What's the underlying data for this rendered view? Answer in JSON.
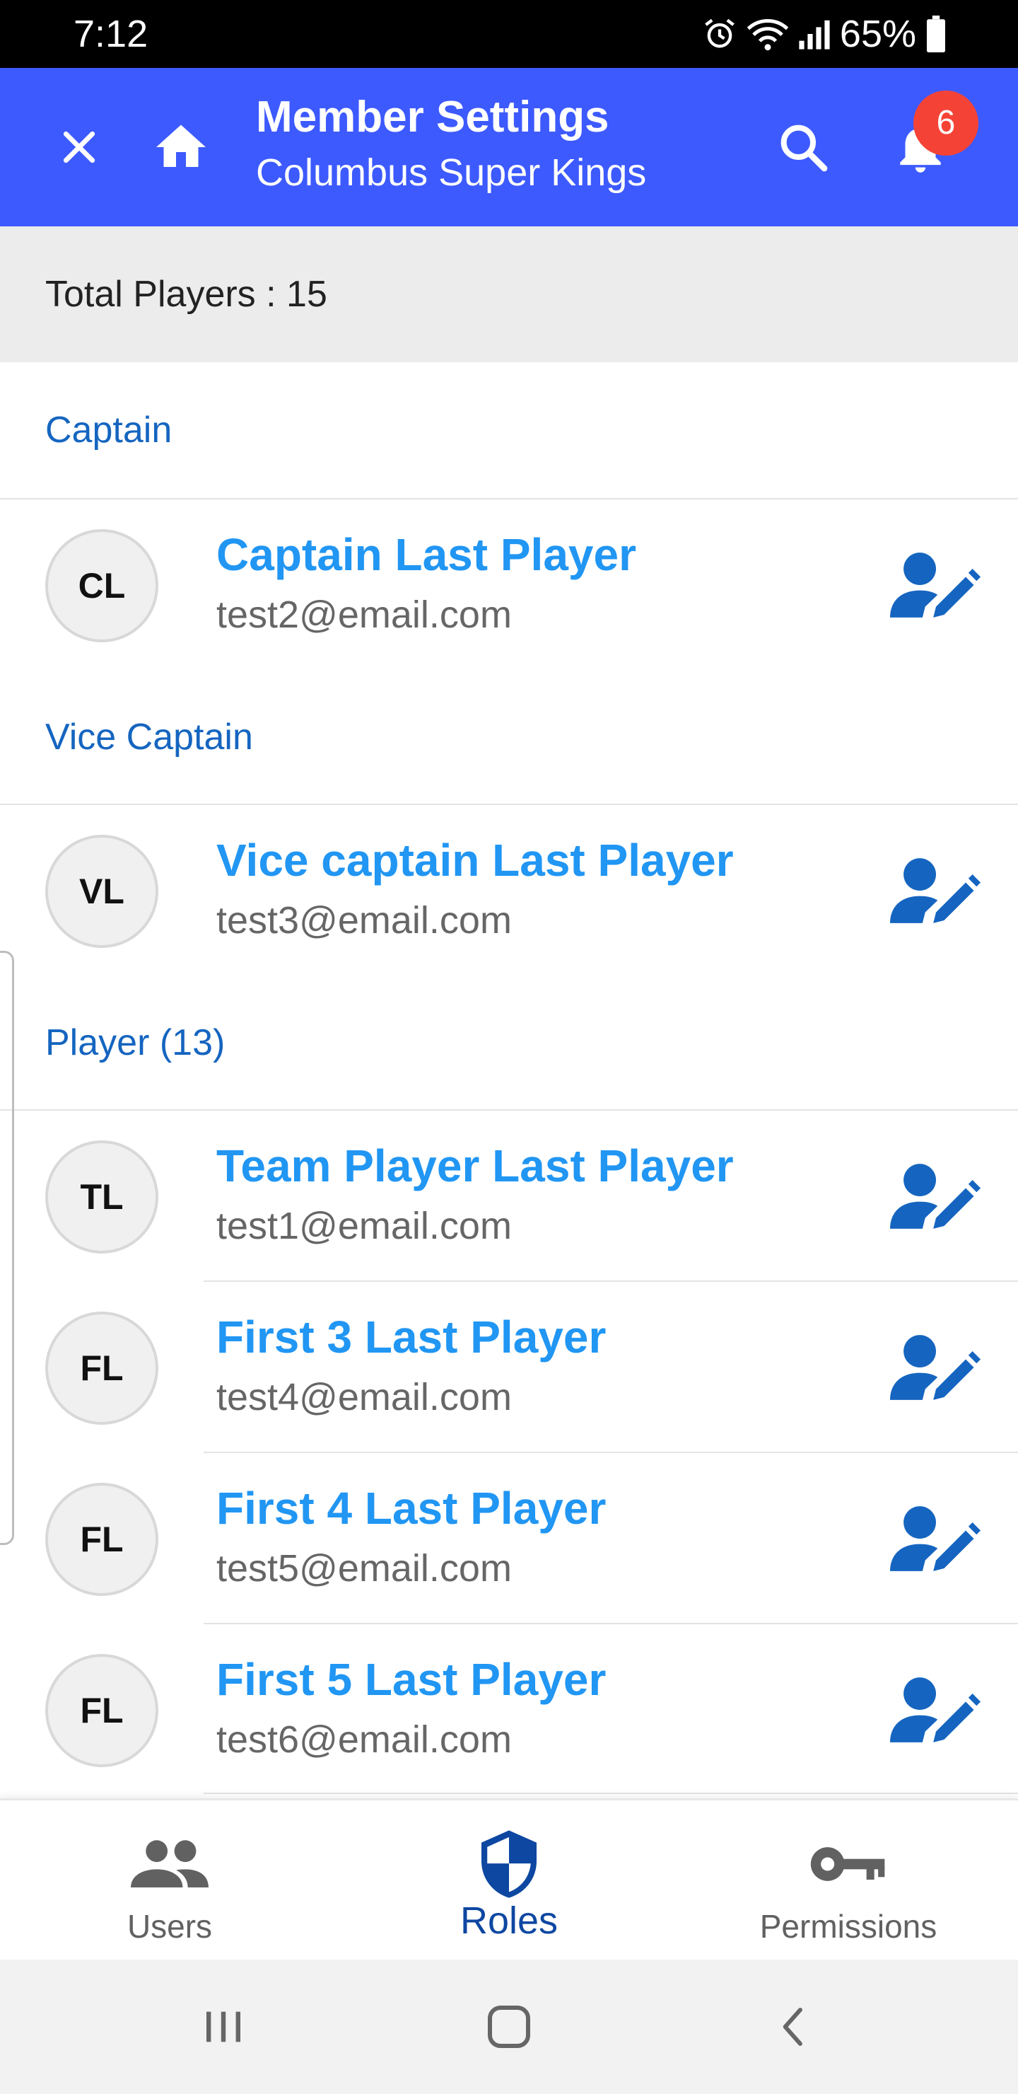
{
  "status_bar": {
    "time": "7:12",
    "battery_percent": "65%",
    "icons": [
      "alarm-icon",
      "wifi-icon",
      "signal-icon",
      "battery-icon"
    ]
  },
  "app_bar": {
    "title": "Member Settings",
    "subtitle": "Columbus Super Kings",
    "notification_count": "6",
    "color": "#3d5afe"
  },
  "summary": {
    "total_players": "Total Players : 15"
  },
  "sections": [
    {
      "header": "Captain",
      "members": [
        {
          "initials": "CL",
          "name": "Captain Last Player",
          "email": "test2@email.com"
        }
      ]
    },
    {
      "header": "Vice Captain",
      "members": [
        {
          "initials": "VL",
          "name": "Vice captain Last Player",
          "email": "test3@email.com"
        }
      ]
    },
    {
      "header": "Player (13)",
      "members": [
        {
          "initials": "TL",
          "name": "Team Player Last Player",
          "email": "test1@email.com"
        },
        {
          "initials": "FL",
          "name": "First 3 Last Player",
          "email": "test4@email.com"
        },
        {
          "initials": "FL",
          "name": "First 4 Last Player",
          "email": "test5@email.com"
        },
        {
          "initials": "FL",
          "name": "First 5 Last Player",
          "email": "test6@email.com"
        }
      ]
    }
  ],
  "bottom_nav": {
    "items": [
      {
        "label": "Users",
        "icon": "users-icon",
        "active": false
      },
      {
        "label": "Roles",
        "icon": "shield-icon",
        "active": true
      },
      {
        "label": "Permissions",
        "icon": "key-icon",
        "active": false
      }
    ]
  },
  "colors": {
    "accent": "#3d5afe",
    "name_text": "#2196f3",
    "section_header": "#1565c0",
    "edit_icon": "#1565c0",
    "badge": "#f44336"
  }
}
